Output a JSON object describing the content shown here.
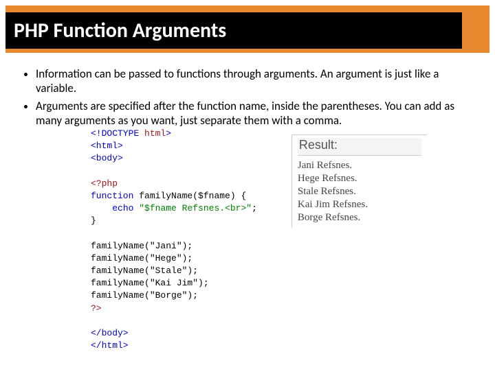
{
  "title": "PHP Function Arguments",
  "bullets": [
    "Information can be passed to functions through arguments. An argument is just like a variable.",
    "Arguments are specified after the function name, inside the parentheses. You can add as many arguments as you want, just separate them with a comma."
  ],
  "code": {
    "doctype_open": "<!DOCTYPE",
    "doctype_html": " html",
    "doctype_close": ">",
    "html_open": "<html>",
    "body_open": "<body>",
    "php_open": "<?php",
    "func_kw": "function",
    "func_name": " familyName($fname) {",
    "echo_kw": "echo",
    "echo_str": " \"$fname Refsnes.<br>\"",
    "echo_semi": ";",
    "brace_close": "}",
    "calls": [
      "familyName(\"Jani\");",
      "familyName(\"Hege\");",
      "familyName(\"Stale\");",
      "familyName(\"Kai Jim\");",
      "familyName(\"Borge\");"
    ],
    "php_close": "?>",
    "body_close": "</body>",
    "html_close": "</html>"
  },
  "result": {
    "label": "Result:",
    "lines": [
      "Jani Refsnes.",
      "Hege Refsnes.",
      "Stale Refsnes.",
      "Kai Jim Refsnes.",
      "Borge Refsnes."
    ]
  }
}
